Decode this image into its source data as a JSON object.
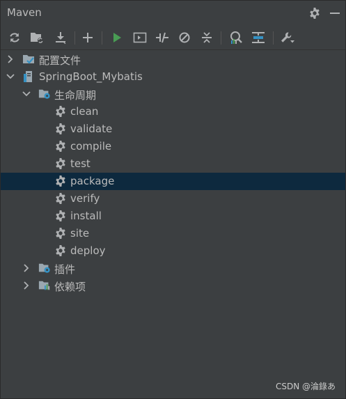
{
  "header": {
    "title": "Maven",
    "settings_icon": "gear-icon",
    "hide_icon": "minimize-icon"
  },
  "toolbar": {
    "buttons": [
      {
        "name": "reload-icon"
      },
      {
        "name": "generate-sources-icon"
      },
      {
        "name": "download-icon"
      },
      {
        "name": "add-icon"
      },
      {
        "name": "run-icon"
      },
      {
        "name": "execute-goal-icon"
      },
      {
        "name": "toggle-offline-icon"
      },
      {
        "name": "skip-tests-icon"
      },
      {
        "name": "collapse-icon"
      },
      {
        "name": "show-dependencies-icon"
      },
      {
        "name": "expand-icon"
      },
      {
        "name": "settings-wrench-icon"
      }
    ],
    "colors": {
      "run": "#499c54",
      "accent": "#3592c4"
    }
  },
  "tree": {
    "config_files": "配置文件",
    "project": "SpringBoot_Mybatis",
    "lifecycle": "生命周期",
    "goals": [
      "clean",
      "validate",
      "compile",
      "test",
      "package",
      "verify",
      "install",
      "site",
      "deploy"
    ],
    "selected_goal": "package",
    "plugins": "插件",
    "dependencies": "依赖项"
  },
  "watermark": "CSDN @淪錄あ",
  "colors": {
    "background": "#3c3f41",
    "selection": "#0d293e",
    "text": "#bbbbbb"
  }
}
